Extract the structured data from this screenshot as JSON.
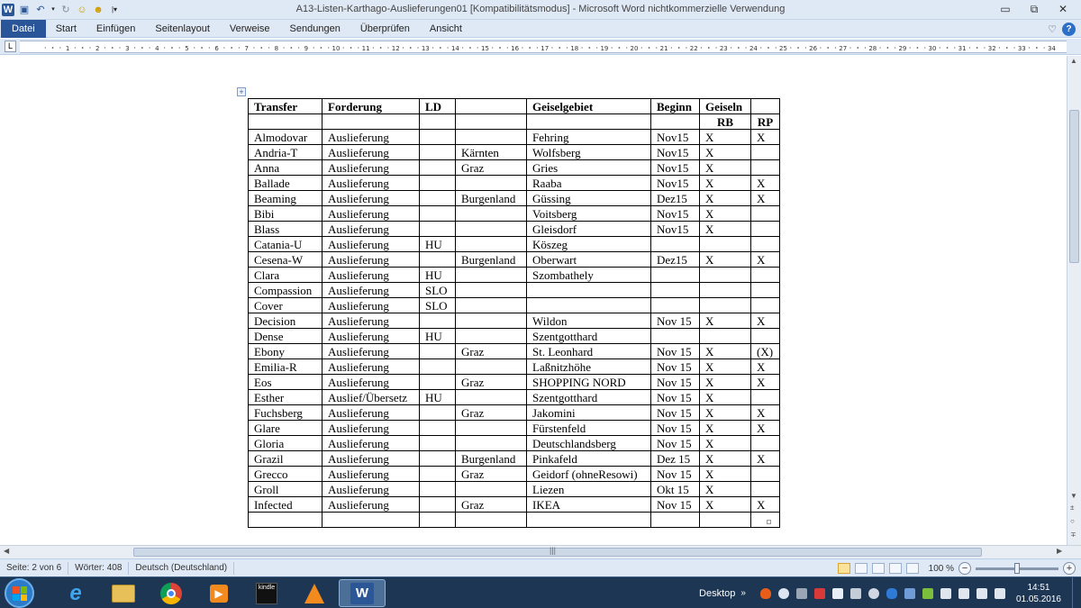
{
  "window": {
    "title": "A13-Listen-Karthago-Auslieferungen01 [Kompatibilitätsmodus]  -  Microsoft Word nichtkommerzielle Verwendung",
    "controls": {
      "minimize": "▭",
      "restore": "⧉",
      "close": "✕"
    }
  },
  "ribbon": {
    "tabs": [
      "Datei",
      "Start",
      "Einfügen",
      "Seitenlayout",
      "Verweise",
      "Sendungen",
      "Überprüfen",
      "Ansicht"
    ],
    "collapse_glyph": "♡",
    "help_glyph": "?"
  },
  "ruler": {
    "tab_selector": "L",
    "numbers": [
      "1",
      "2",
      "3",
      "4",
      "5",
      "6",
      "7",
      "8",
      "9",
      "10",
      "11",
      "12",
      "13",
      "14",
      "15",
      "16",
      "17",
      "18",
      "19",
      "20",
      "21",
      "22",
      "23",
      "24",
      "25",
      "26",
      "27",
      "28",
      "29",
      "30",
      "31",
      "32",
      "33",
      "34"
    ]
  },
  "table": {
    "move_handle_glyph": "+",
    "headers": [
      "Transfer",
      "Forderung",
      "LD",
      "",
      "Geiselgebiet",
      "Beginn",
      "Geiseln",
      ""
    ],
    "subheaders": [
      "",
      "",
      "",
      "",
      "",
      "",
      "RB",
      "RP"
    ],
    "rows": [
      [
        "Almodovar",
        "Auslieferung",
        "",
        "",
        "Fehring",
        "Nov15",
        "X",
        "X"
      ],
      [
        "Andria-T",
        "Auslieferung",
        "",
        "Kärnten",
        "Wolfsberg",
        "Nov15",
        "X",
        ""
      ],
      [
        "Anna",
        "Auslieferung",
        "",
        "Graz",
        "Gries",
        "Nov15",
        "X",
        ""
      ],
      [
        "Ballade",
        "Auslieferung",
        "",
        "",
        "Raaba",
        "Nov15",
        "X",
        "X"
      ],
      [
        "Beaming",
        "Auslieferung",
        "",
        "Burgenland",
        "Güssing",
        "Dez15",
        "X",
        "X"
      ],
      [
        "Bibi",
        "Auslieferung",
        "",
        "",
        "Voitsberg",
        "Nov15",
        "X",
        ""
      ],
      [
        "Blass",
        "Auslieferung",
        "",
        "",
        "Gleisdorf",
        "Nov15",
        "X",
        ""
      ],
      [
        "Catania-U",
        "Auslieferung",
        "HU",
        "",
        "Köszeg",
        "",
        "",
        ""
      ],
      [
        "Cesena-W",
        "Auslieferung",
        "",
        "Burgenland",
        "Oberwart",
        "Dez15",
        "X",
        "X"
      ],
      [
        "Clara",
        "Auslieferung",
        "HU",
        "",
        "Szombathely",
        "",
        "",
        ""
      ],
      [
        "Compassion",
        "Auslieferung",
        "SLO",
        "",
        "",
        "",
        "",
        ""
      ],
      [
        "Cover",
        "Auslieferung",
        "SLO",
        "",
        "",
        "",
        "",
        ""
      ],
      [
        "Decision",
        "Auslieferung",
        "",
        "",
        "Wildon",
        "Nov 15",
        "X",
        "X"
      ],
      [
        "Dense",
        "Auslieferung",
        "HU",
        "",
        "Szentgotthard",
        "",
        "",
        ""
      ],
      [
        "Ebony",
        "Auslieferung",
        "",
        "Graz",
        "St. Leonhard",
        "Nov 15",
        "X",
        "(X)"
      ],
      [
        "Emilia-R",
        "Auslieferung",
        "",
        "",
        "Laßnitzhöhe",
        "Nov 15",
        "X",
        "X"
      ],
      [
        "Eos",
        "Auslieferung",
        "",
        "Graz",
        "SHOPPING NORD",
        "Nov 15",
        "X",
        "X"
      ],
      [
        "Esther",
        "Auslief/Übersetz",
        "HU",
        "",
        "Szentgotthard",
        "Nov 15",
        "X",
        ""
      ],
      [
        "Fuchsberg",
        "Auslieferung",
        "",
        "Graz",
        "Jakomini",
        "Nov 15",
        "X",
        "X"
      ],
      [
        "Glare",
        "Auslieferung",
        "",
        "",
        "Fürstenfeld",
        "Nov 15",
        "X",
        "X"
      ],
      [
        "Gloria",
        "Auslieferung",
        "",
        "",
        "Deutschlandsberg",
        "Nov 15",
        "X",
        ""
      ],
      [
        "Grazil",
        "Auslieferung",
        "",
        "Burgenland",
        "Pinkafeld",
        "Dez 15",
        "X",
        "X"
      ],
      [
        "Grecco",
        "Auslieferung",
        "",
        "Graz",
        "Geidorf (ohneResowi)",
        "Nov 15",
        "X",
        ""
      ],
      [
        "Groll",
        "Auslieferung",
        "",
        "",
        "Liezen",
        "Okt 15",
        "X",
        ""
      ],
      [
        "Infected",
        "Auslieferung",
        "",
        "Graz",
        "IKEA",
        "Nov 15",
        "X",
        "X"
      ],
      [
        "",
        "",
        "",
        "",
        "",
        "",
        "",
        ""
      ]
    ]
  },
  "statusbar": {
    "page": "Seite: 2 von 6",
    "words": "Wörter: 408",
    "language": "Deutsch (Deutschland)",
    "zoom": "100 %",
    "zoom_value": 100
  },
  "taskbar": {
    "apps": [
      "internet-explorer",
      "file-explorer",
      "chrome",
      "media-player",
      "kindle",
      "vlc",
      "word"
    ],
    "kindle_label": "kindle",
    "word_label": "W",
    "desktop_label": "Desktop",
    "chevron": "»",
    "time": "14:51",
    "date": "01.05.2016"
  },
  "colors": {
    "ribbon_bg": "#dfe9f5",
    "file_tab": "#2a5699",
    "taskbar": "#1d3654"
  }
}
